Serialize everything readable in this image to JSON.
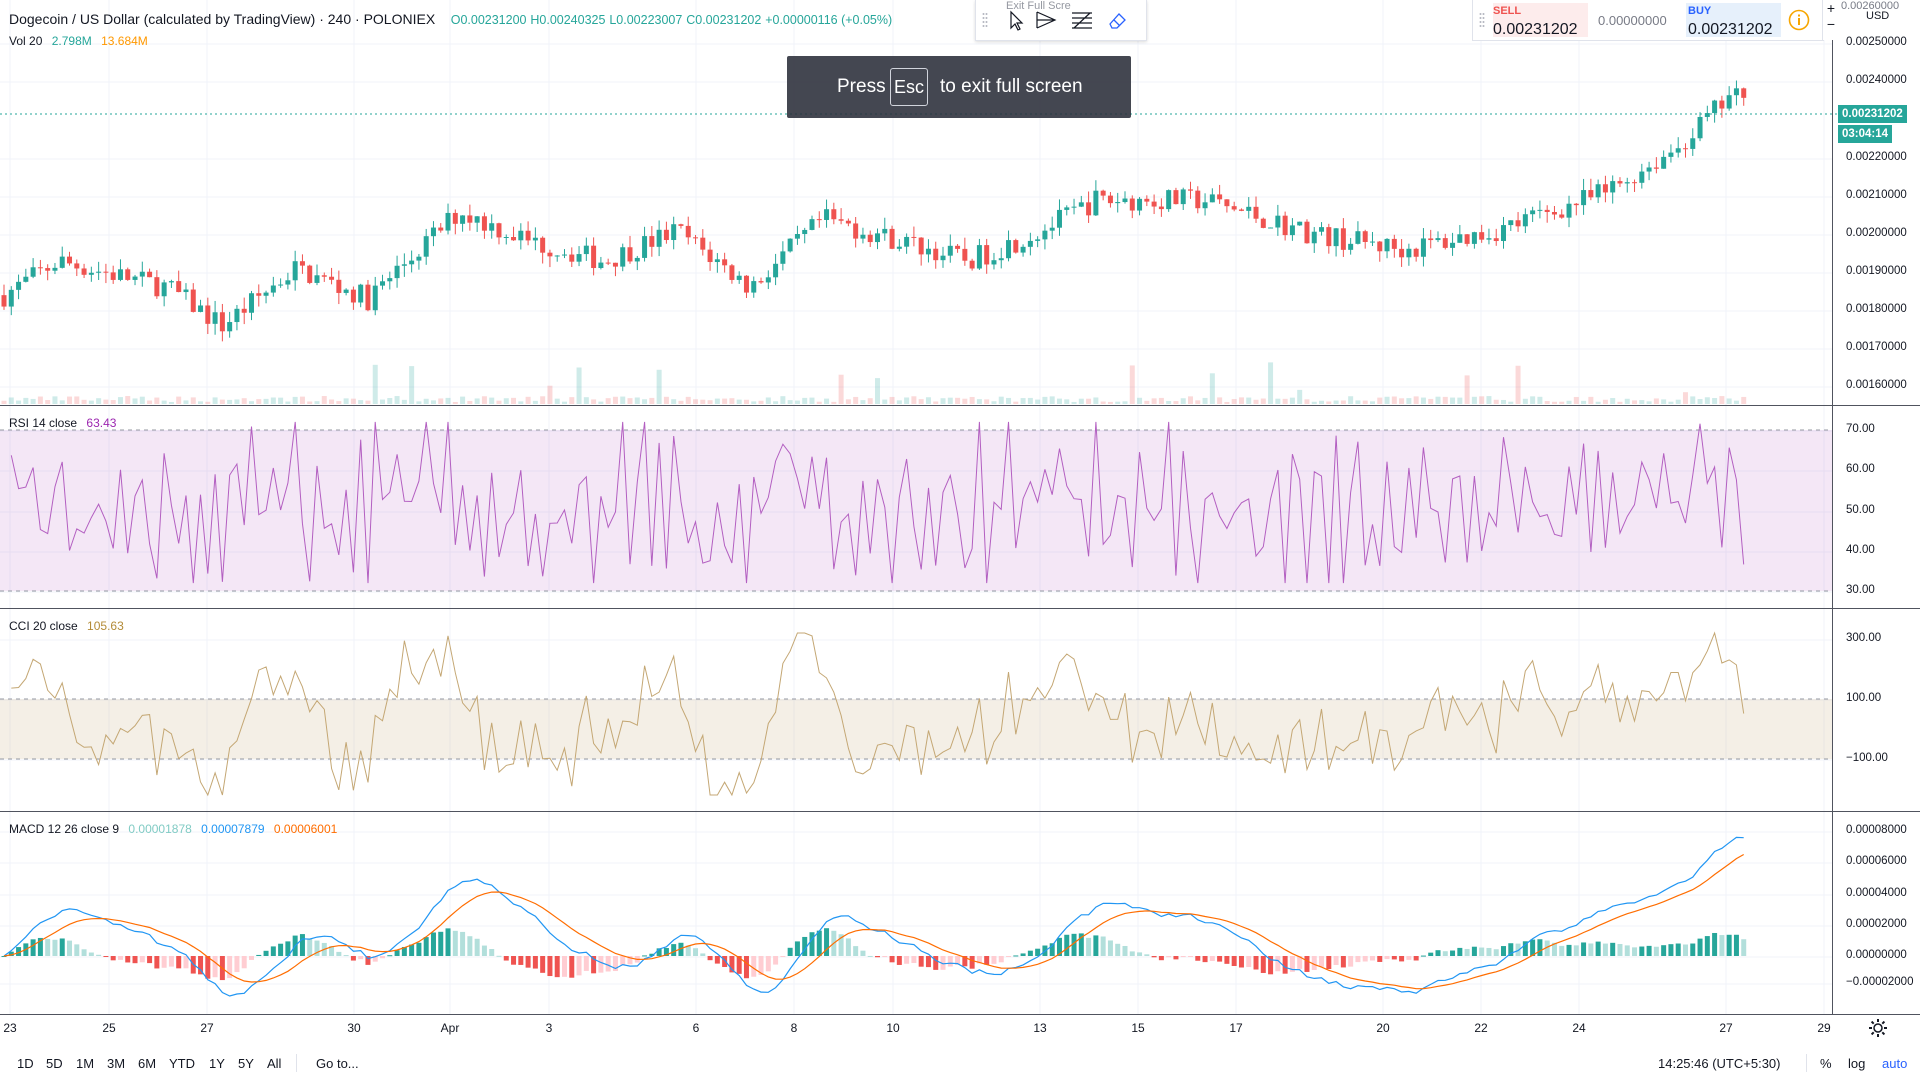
{
  "header": {
    "symbol_title": "Dogecoin / US Dollar (calculated by TradingView) · 240 · POLONIEX",
    "open": "O0.00231200",
    "high": "H0.00240325",
    "low": "L0.00223007",
    "close": "C0.00231202",
    "change": "+0.00000116 (+0.05%)"
  },
  "volume_legend": {
    "label": "Vol 20",
    "v1": "2.798M",
    "v2": "13.684M"
  },
  "rsi_legend": {
    "label": "RSI 14 close",
    "value": "63.43"
  },
  "cci_legend": {
    "label": "CCI 20 close",
    "value": "105.63"
  },
  "macd_legend": {
    "label": "MACD 12 26 close 9",
    "hist": "0.00001878",
    "macd": "0.00007879",
    "signal": "0.00006001"
  },
  "toolbar": {
    "exit_label": "Exit Full Scre"
  },
  "trade": {
    "sell_label": "SELL",
    "sell_price": "0.00231202",
    "spread": "0.00000000",
    "buy_label": "BUY",
    "buy_price": "0.00231202"
  },
  "scale_controls": {
    "plus": "+",
    "minus": "−",
    "currency": "USD"
  },
  "fullscreen_toast": {
    "press": "Press",
    "key": "Esc",
    "rest": "to exit full screen"
  },
  "price_axis": {
    "top_partial": "0.00260000",
    "ticks": [
      "0.00250000",
      "0.00240000",
      "0.00220000",
      "0.00210000",
      "0.00200000",
      "0.00190000",
      "0.00180000",
      "0.00170000",
      "0.00160000"
    ],
    "last_price": "0.00231202",
    "countdown": "03:04:14"
  },
  "rsi_axis": {
    "ticks": [
      "70.00",
      "60.00",
      "50.00",
      "40.00",
      "30.00"
    ]
  },
  "cci_axis": {
    "ticks": [
      "300.00",
      "100.00",
      "−100.00"
    ]
  },
  "macd_axis": {
    "ticks": [
      "0.00008000",
      "0.00006000",
      "0.00004000",
      "0.00002000",
      "0.00000000",
      "−0.00002000"
    ]
  },
  "time_axis": {
    "labels": [
      "23",
      "25",
      "27",
      "30",
      "Apr",
      "3",
      "6",
      "8",
      "10",
      "13",
      "15",
      "17",
      "20",
      "22",
      "24",
      "27",
      "29"
    ]
  },
  "bottom_bar": {
    "ranges": [
      "1D",
      "5D",
      "1M",
      "3M",
      "6M",
      "YTD",
      "1Y",
      "5Y",
      "All"
    ],
    "goto": "Go to...",
    "clock": "14:25:46 (UTC+5:30)",
    "percent": "%",
    "log": "log",
    "auto": "auto"
  },
  "colors": {
    "up": "#26a69a",
    "down": "#ef5350",
    "rsi": "#b35fc1",
    "cci": "#c4a774",
    "macd": "#2196f3",
    "signal": "#ff6d00"
  }
}
